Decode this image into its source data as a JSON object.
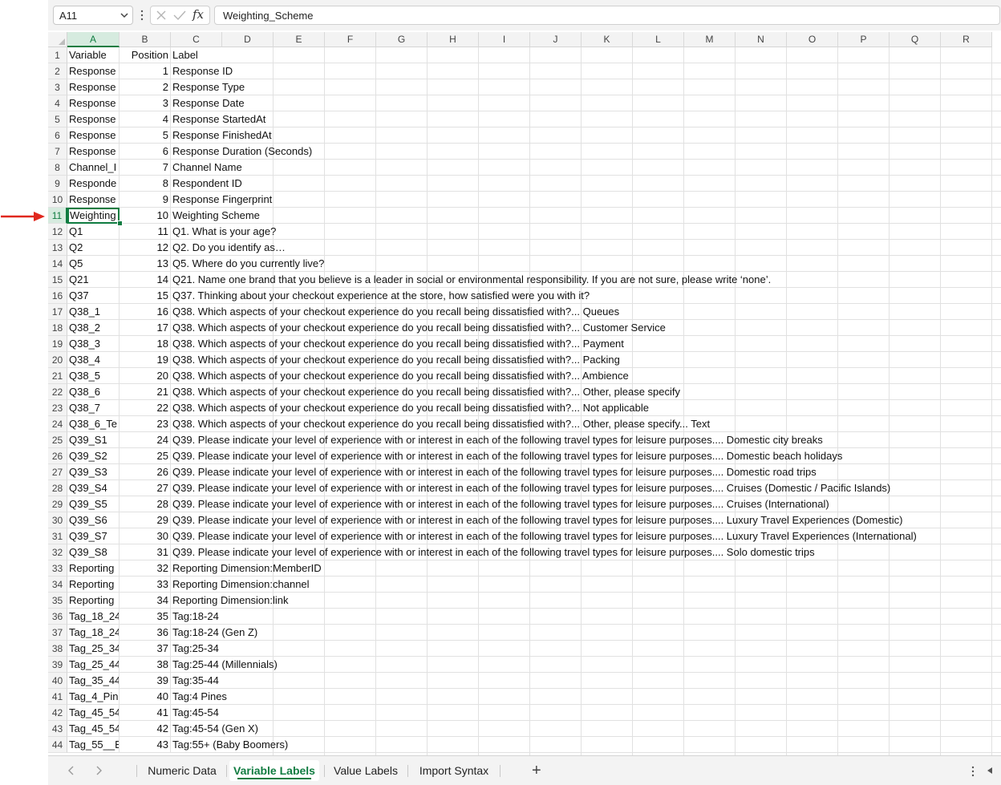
{
  "formula_bar": {
    "name_box": "A11",
    "formula": "Weighting_Scheme",
    "fx_label": "fx"
  },
  "columns": [
    "A",
    "B",
    "C",
    "D",
    "E",
    "F",
    "G",
    "H",
    "I",
    "J",
    "K",
    "L",
    "M",
    "N",
    "O",
    "P",
    "Q",
    "R"
  ],
  "rows": [
    {
      "num": "1",
      "a": "Variable",
      "b": "Position",
      "c": "Label"
    },
    {
      "num": "2",
      "a": "Response",
      "b": "1",
      "c": "Response ID"
    },
    {
      "num": "3",
      "a": "Response",
      "b": "2",
      "c": "Response Type"
    },
    {
      "num": "4",
      "a": "Response",
      "b": "3",
      "c": "Response Date"
    },
    {
      "num": "5",
      "a": "Response",
      "b": "4",
      "c": "Response StartedAt"
    },
    {
      "num": "6",
      "a": "Response",
      "b": "5",
      "c": "Response FinishedAt"
    },
    {
      "num": "7",
      "a": "Response",
      "b": "6",
      "c": "Response Duration (Seconds)"
    },
    {
      "num": "8",
      "a": "Channel_I",
      "b": "7",
      "c": "Channel Name"
    },
    {
      "num": "9",
      "a": "Responde",
      "b": "8",
      "c": "Respondent ID"
    },
    {
      "num": "10",
      "a": "Response",
      "b": "9",
      "c": "Response Fingerprint"
    },
    {
      "num": "11",
      "a": "Weighting",
      "b": "10",
      "c": "Weighting Scheme"
    },
    {
      "num": "12",
      "a": "Q1",
      "b": "11",
      "c": "Q1. What is your age?"
    },
    {
      "num": "13",
      "a": "Q2",
      "b": "12",
      "c": "Q2. Do you identify as…"
    },
    {
      "num": "14",
      "a": "Q5",
      "b": "13",
      "c": "Q5. Where do you currently live?"
    },
    {
      "num": "15",
      "a": "Q21",
      "b": "14",
      "c": "Q21. Name one brand that you believe is a leader in social or environmental responsibility. If you are not sure, please write ‘none’."
    },
    {
      "num": "16",
      "a": "Q37",
      "b": "15",
      "c": "Q37. Thinking about your checkout experience at the store, how satisfied were you with it?"
    },
    {
      "num": "17",
      "a": "Q38_1",
      "b": "16",
      "c": "Q38. Which aspects of your checkout experience do you recall being dissatisfied with?... Queues"
    },
    {
      "num": "18",
      "a": "Q38_2",
      "b": "17",
      "c": "Q38. Which aspects of your checkout experience do you recall being dissatisfied with?... Customer Service"
    },
    {
      "num": "19",
      "a": "Q38_3",
      "b": "18",
      "c": "Q38. Which aspects of your checkout experience do you recall being dissatisfied with?... Payment"
    },
    {
      "num": "20",
      "a": "Q38_4",
      "b": "19",
      "c": "Q38. Which aspects of your checkout experience do you recall being dissatisfied with?... Packing"
    },
    {
      "num": "21",
      "a": "Q38_5",
      "b": "20",
      "c": "Q38. Which aspects of your checkout experience do you recall being dissatisfied with?... Ambience"
    },
    {
      "num": "22",
      "a": "Q38_6",
      "b": "21",
      "c": "Q38. Which aspects of your checkout experience do you recall being dissatisfied with?... Other, please specify"
    },
    {
      "num": "23",
      "a": "Q38_7",
      "b": "22",
      "c": "Q38. Which aspects of your checkout experience do you recall being dissatisfied with?... Not applicable"
    },
    {
      "num": "24",
      "a": "Q38_6_Te",
      "b": "23",
      "c": "Q38. Which aspects of your checkout experience do you recall being dissatisfied with?... Other, please specify... Text"
    },
    {
      "num": "25",
      "a": "Q39_S1",
      "b": "24",
      "c": "Q39. Please indicate your level of experience with or interest in each of the following travel types for leisure purposes.... Domestic city breaks"
    },
    {
      "num": "26",
      "a": "Q39_S2",
      "b": "25",
      "c": "Q39. Please indicate your level of experience with or interest in each of the following travel types for leisure purposes.... Domestic beach holidays"
    },
    {
      "num": "27",
      "a": "Q39_S3",
      "b": "26",
      "c": "Q39. Please indicate your level of experience with or interest in each of the following travel types for leisure purposes.... Domestic road trips"
    },
    {
      "num": "28",
      "a": "Q39_S4",
      "b": "27",
      "c": "Q39. Please indicate your level of experience with or interest in each of the following travel types for leisure purposes.... Cruises (Domestic / Pacific Islands)"
    },
    {
      "num": "29",
      "a": "Q39_S5",
      "b": "28",
      "c": "Q39. Please indicate your level of experience with or interest in each of the following travel types for leisure purposes.... Cruises (International)"
    },
    {
      "num": "30",
      "a": "Q39_S6",
      "b": "29",
      "c": "Q39. Please indicate your level of experience with or interest in each of the following travel types for leisure purposes.... Luxury Travel Experiences (Domestic)"
    },
    {
      "num": "31",
      "a": "Q39_S7",
      "b": "30",
      "c": "Q39. Please indicate your level of experience with or interest in each of the following travel types for leisure purposes.... Luxury Travel Experiences (International)"
    },
    {
      "num": "32",
      "a": "Q39_S8",
      "b": "31",
      "c": "Q39. Please indicate your level of experience with or interest in each of the following travel types for leisure purposes.... Solo domestic trips"
    },
    {
      "num": "33",
      "a": "Reporting",
      "b": "32",
      "c": "Reporting Dimension:MemberID"
    },
    {
      "num": "34",
      "a": "Reporting",
      "b": "33",
      "c": "Reporting Dimension:channel"
    },
    {
      "num": "35",
      "a": "Reporting",
      "b": "34",
      "c": "Reporting Dimension:link"
    },
    {
      "num": "36",
      "a": "Tag_18_24",
      "b": "35",
      "c": "Tag:18-24"
    },
    {
      "num": "37",
      "a": "Tag_18_24",
      "b": "36",
      "c": "Tag:18-24 (Gen Z)"
    },
    {
      "num": "38",
      "a": "Tag_25_34",
      "b": "37",
      "c": "Tag:25-34"
    },
    {
      "num": "39",
      "a": "Tag_25_44",
      "b": "38",
      "c": "Tag:25-44 (Millennials)"
    },
    {
      "num": "40",
      "a": "Tag_35_44",
      "b": "39",
      "c": "Tag:35-44"
    },
    {
      "num": "41",
      "a": "Tag_4_Pin",
      "b": "40",
      "c": "Tag:4 Pines"
    },
    {
      "num": "42",
      "a": "Tag_45_54",
      "b": "41",
      "c": "Tag:45-54"
    },
    {
      "num": "43",
      "a": "Tag_45_54",
      "b": "42",
      "c": "Tag:45-54 (Gen X)"
    },
    {
      "num": "44",
      "a": "Tag_55__E",
      "b": "43",
      "c": "Tag:55+ (Baby Boomers)"
    }
  ],
  "sheet_tabs": [
    "Numeric Data",
    "Variable Labels",
    "Value Labels",
    "Import Syntax"
  ],
  "active_tab": "Variable Labels",
  "active_cell": {
    "column": "A",
    "row": "11"
  },
  "colors": {
    "accent": "#107c41",
    "arrow": "#e0281e",
    "header_bg": "#f3f3f3",
    "gridline": "#e1e1e1"
  }
}
